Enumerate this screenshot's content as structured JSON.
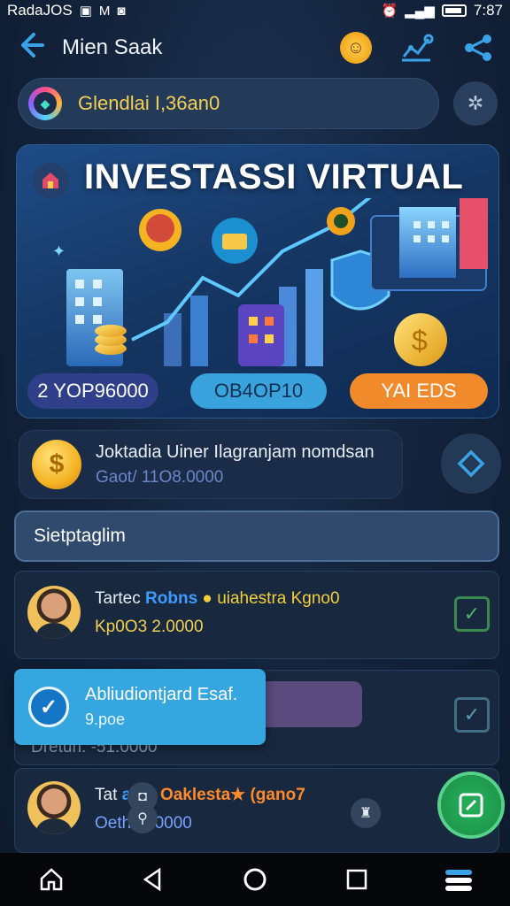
{
  "status_bar": {
    "carrier": "RadaJOS",
    "icons": [
      "photo-icon",
      "mail-icon",
      "messenger-icon"
    ],
    "right_icons": [
      "alarm-icon",
      "signal-icon",
      "wifi-icon",
      "battery-icon"
    ],
    "time": "7:87"
  },
  "app_bar": {
    "title": "Mien Saak",
    "actions": [
      "emoji-icon",
      "chart-icon",
      "share-icon"
    ]
  },
  "balance": {
    "label": "Glendlai I,36an0"
  },
  "banner": {
    "title": "INVESTASSI VIRTUAL",
    "chips": [
      "2 YOP96000",
      "OB4OP10",
      "YAI EDS"
    ]
  },
  "notice": {
    "title": "Joktadia Uiner Ilagranjam nomdsan",
    "subtitle": "Gaot/ 11O8.0000"
  },
  "section": {
    "title": "Sietptaglim"
  },
  "rows": [
    {
      "name_prefix": "Tartec",
      "name_highlight": "Robns",
      "tag": "uiahestra Kgno0",
      "amount": "Kp0O3 2.0000"
    },
    {
      "under_text": "Dretun: -51.0000"
    },
    {
      "name_prefix": "Tat",
      "name_highlight": "aiok",
      "tag": "Oaklesta★ (gano7",
      "amount": "Oeth 2 .0000"
    }
  ],
  "toast": {
    "title": "Abliudiontjard Esaf.",
    "subtitle": "9.poe"
  },
  "nav": [
    "home-icon",
    "back-triangle-icon",
    "home-circle-icon",
    "recents-square-icon",
    "menu-icon"
  ],
  "colors": {
    "accent_blue": "#3aa3e8",
    "gold": "#f3cf53",
    "toast_blue": "#35a6e0",
    "fab_green": "#25b05a"
  }
}
